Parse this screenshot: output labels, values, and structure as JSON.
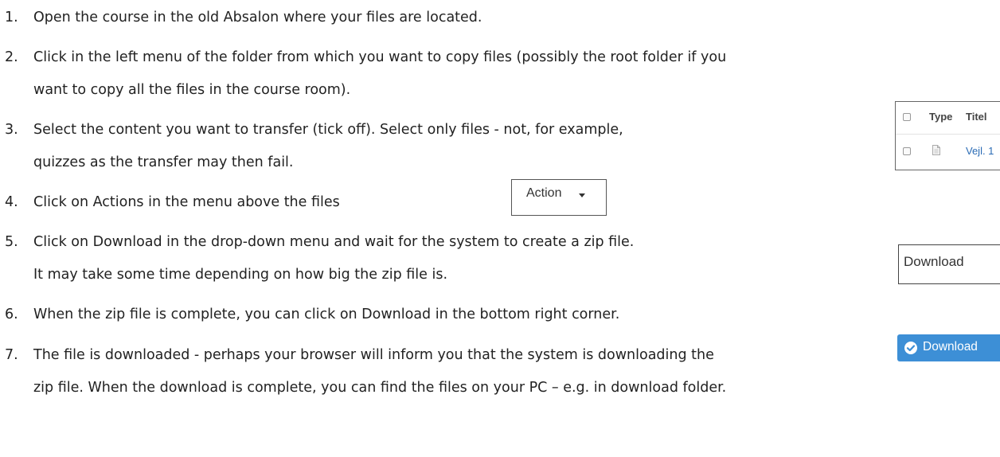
{
  "steps": [
    {
      "number": "1.",
      "lines": [
        "Open the course in the old Absalon where your files are located."
      ]
    },
    {
      "number": "2.",
      "lines": [
        "Click in the left menu of the folder from which you want to copy files (possibly the root folder if you",
        "want to copy all the files in the course room)."
      ]
    },
    {
      "number": "3.",
      "lines": [
        "Select the content you want to transfer (tick off). Select only files - not, for example,",
        "quizzes as the transfer may then fail."
      ]
    },
    {
      "number": "4.",
      "lines": [
        "Click on Actions in the menu above the files"
      ]
    },
    {
      "number": "5.",
      "lines": [
        "Click on Download in the drop-down menu and wait for the system to create a zip file.",
        "It may take some time depending on how big the zip file is."
      ]
    },
    {
      "number": "6.",
      "lines": [
        "When the zip file is complete, you can click on Download in the bottom right corner."
      ]
    },
    {
      "number": "7.",
      "lines": [
        "The file is downloaded - perhaps your browser will inform you that the system is downloading the",
        "zip file. When the download is complete, you can find the files on your PC – e.g. in download folder."
      ]
    }
  ],
  "file_table_snippet": {
    "header_type": "Type",
    "header_titel": "Titel",
    "row_title": "Vejl. 1"
  },
  "action_snippet": {
    "label": "Action"
  },
  "download_menu_snippet": {
    "label": "Download"
  },
  "download_button_snippet": {
    "label": "Download",
    "color": "#3d8fd6"
  }
}
